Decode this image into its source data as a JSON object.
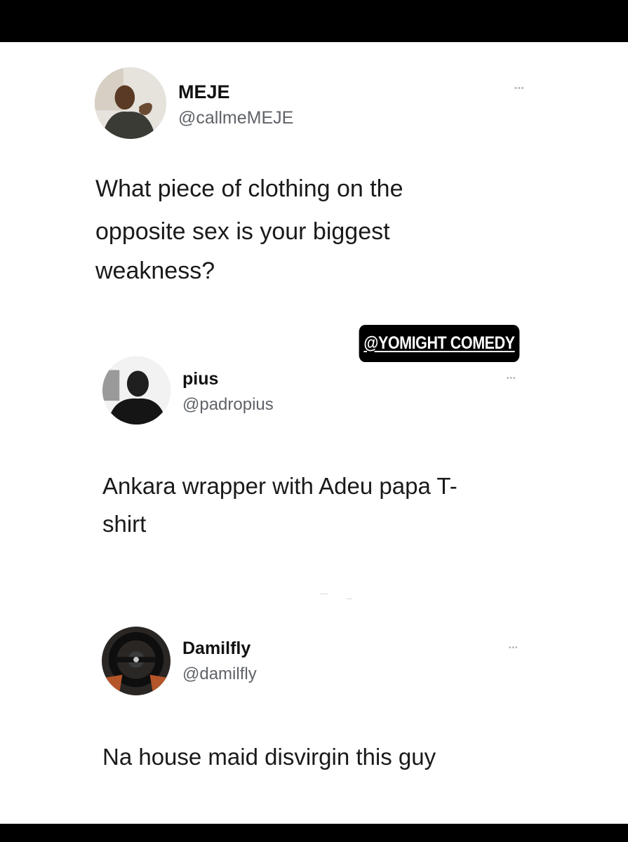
{
  "tweets": [
    {
      "display_name": "MEJE",
      "handle": "@callmeMEJE",
      "text_lines": [
        "What piece of clothing on the",
        "opposite sex is your biggest",
        "weakness?"
      ],
      "more": "•••"
    },
    {
      "display_name": "pius",
      "handle": "@padropius",
      "text_lines": [
        "Ankara wrapper with Adeu papa T-",
        "shirt"
      ],
      "more": "•••"
    },
    {
      "display_name": "Damilfly",
      "handle": "@damilfly",
      "text_lines": [
        "Na house maid disvirgin this guy"
      ],
      "more": "•••"
    }
  ],
  "watermark": "@YOMIGHT COMEDY",
  "colors": {
    "frame": "#000000",
    "background": "#ffffff",
    "name": "#111111",
    "handle": "#5f6368",
    "body": "#1a1a1a",
    "more": "#b8b8b8"
  }
}
